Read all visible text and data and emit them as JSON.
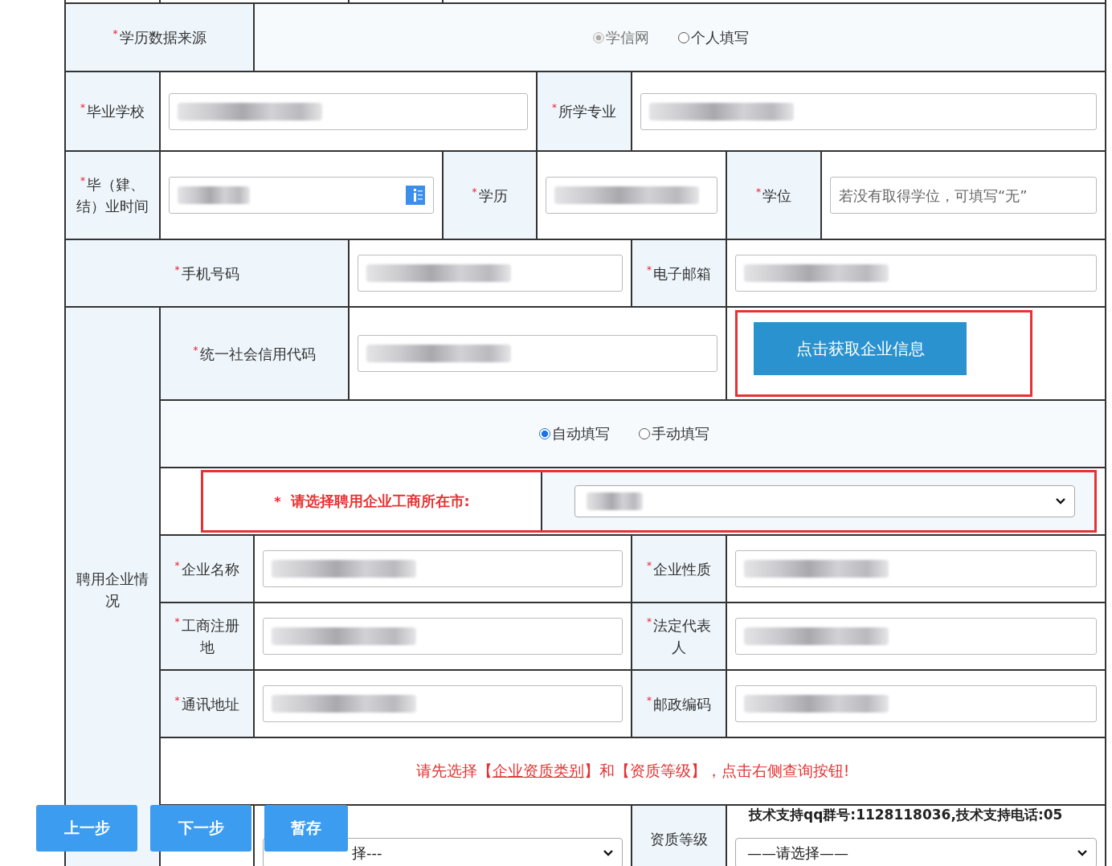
{
  "required_mark": "*",
  "rows": [
    {
      "cells": [
        {
          "kind": "label",
          "text": "学历数据来源",
          "required": true
        },
        {
          "kind": "radios",
          "options": [
            {
              "label": "学信网",
              "selected": true,
              "disabled": true
            },
            {
              "label": "个人填写",
              "selected": false,
              "disabled": false
            }
          ]
        }
      ]
    },
    {
      "cells": [
        {
          "kind": "label",
          "text": "毕业学校",
          "required": true
        },
        {
          "kind": "input",
          "redacted": true
        },
        {
          "kind": "label",
          "text": "所学专业",
          "required": true
        },
        {
          "kind": "input",
          "redacted": true
        }
      ]
    },
    {
      "cells": [
        {
          "kind": "label",
          "text": "毕（肄、结）业时间",
          "required": true
        },
        {
          "kind": "date",
          "redacted": true
        },
        {
          "kind": "label",
          "text": "学历",
          "required": true
        },
        {
          "kind": "input",
          "redacted": true
        },
        {
          "kind": "label",
          "text": "学位",
          "required": true
        },
        {
          "kind": "input",
          "placeholder": "若没有取得学位，可填写“无”"
        }
      ]
    },
    {
      "cells": [
        {
          "kind": "label",
          "text": "手机号码",
          "required": true
        },
        {
          "kind": "input",
          "redacted": true
        },
        {
          "kind": "label",
          "text": "电子邮箱",
          "required": true
        },
        {
          "kind": "input",
          "redacted": true
        }
      ]
    },
    {
      "cells": [
        {
          "kind": "label",
          "text": "统一社会信用代码",
          "required": true
        },
        {
          "kind": "input",
          "redacted": true
        },
        {
          "kind": "button",
          "label": "点击获取企业信息",
          "highlighted": true
        }
      ]
    },
    {
      "cells": [
        {
          "kind": "radios",
          "options": [
            {
              "label": "自动填写",
              "selected": true,
              "disabled": false
            },
            {
              "label": "手动填写",
              "selected": false,
              "disabled": false
            }
          ]
        }
      ]
    },
    {
      "cells": [
        {
          "kind": "highlighted_select",
          "text": "请选择聘用企业工商所在市:",
          "required": true,
          "redacted": true
        }
      ]
    },
    {
      "cells": [
        {
          "kind": "label",
          "text": "企业名称",
          "required": true
        },
        {
          "kind": "input",
          "redacted": true
        },
        {
          "kind": "label",
          "text": "企业性质",
          "required": true
        },
        {
          "kind": "input",
          "redacted": true
        }
      ]
    },
    {
      "cells": [
        {
          "kind": "label",
          "text": "工商注册地",
          "required": true
        },
        {
          "kind": "input",
          "redacted": true
        },
        {
          "kind": "label",
          "text": "法定代表人",
          "required": true
        },
        {
          "kind": "input",
          "redacted": true
        }
      ]
    },
    {
      "cells": [
        {
          "kind": "label",
          "text": "通讯地址",
          "required": true
        },
        {
          "kind": "input",
          "redacted": true
        },
        {
          "kind": "label",
          "text": "邮政编码",
          "required": true
        },
        {
          "kind": "input",
          "redacted": true
        }
      ]
    },
    {
      "cells": [
        {
          "kind": "message",
          "before": "请先选择【",
          "link": "企业资质类别",
          "after": "】和【资质等级】，点击右侧查询按钮!"
        }
      ]
    },
    {
      "cells": [
        {
          "kind": "select",
          "value": "择---"
        },
        {
          "kind": "label",
          "text": "资质等级",
          "required": false
        },
        {
          "kind": "select",
          "value": "——请选择——"
        }
      ]
    }
  ],
  "group_label": "聘用企业情况",
  "nav_buttons": [
    "上一步",
    "下一步",
    "暂存"
  ],
  "support_text": "技术支持qq群号:1128118036,技术支持电话:05"
}
